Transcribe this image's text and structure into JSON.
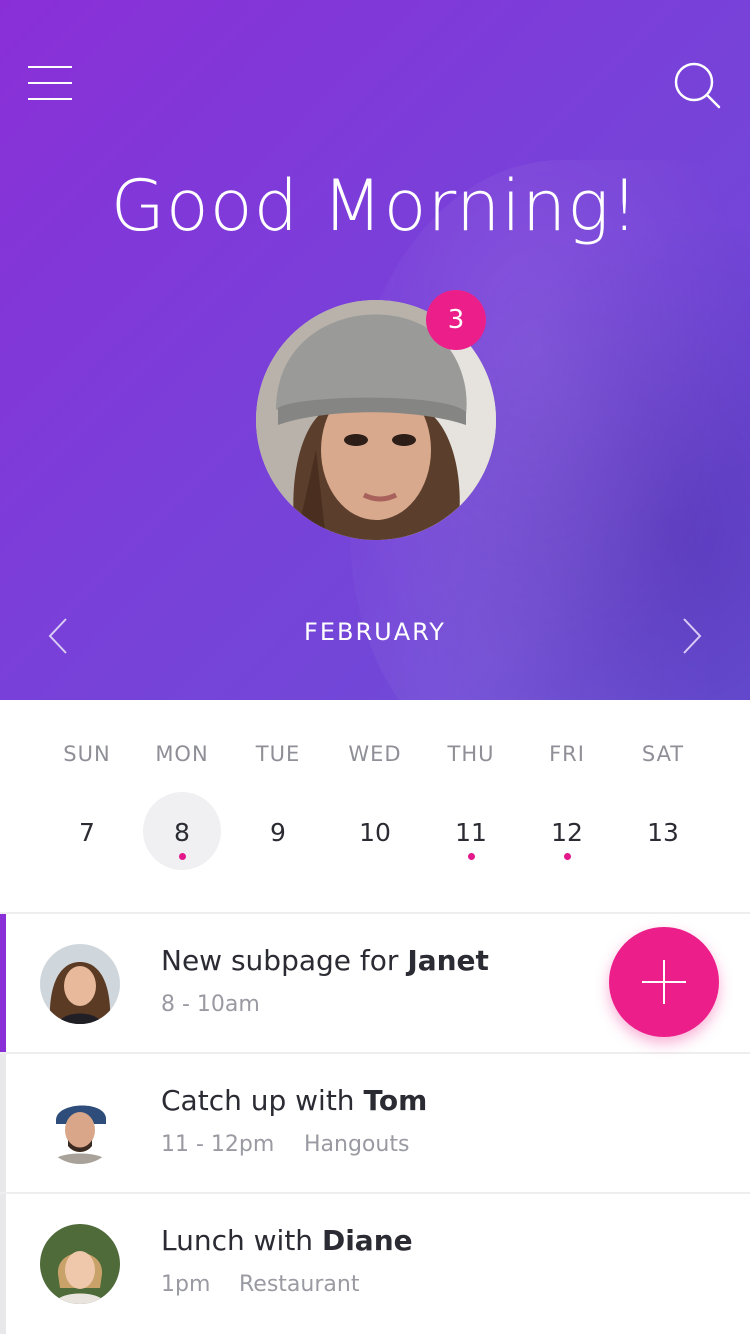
{
  "header": {
    "greeting": "Good Morning!",
    "notification_count": "3",
    "month": "FEBRUARY"
  },
  "week": {
    "days": [
      {
        "name": "SUN",
        "num": "7",
        "selected": false,
        "has_event": false
      },
      {
        "name": "MON",
        "num": "8",
        "selected": true,
        "has_event": true
      },
      {
        "name": "TUE",
        "num": "9",
        "selected": false,
        "has_event": false
      },
      {
        "name": "WED",
        "num": "10",
        "selected": false,
        "has_event": false
      },
      {
        "name": "THU",
        "num": "11",
        "selected": false,
        "has_event": true
      },
      {
        "name": "FRI",
        "num": "12",
        "selected": false,
        "has_event": true
      },
      {
        "name": "SAT",
        "num": "13",
        "selected": false,
        "has_event": false
      }
    ]
  },
  "events": [
    {
      "title_prefix": "New subpage for ",
      "title_name": "Janet",
      "time": "8 - 10am",
      "place": ""
    },
    {
      "title_prefix": "Catch up with ",
      "title_name": "Tom",
      "time": "11 - 12pm",
      "place": "Hangouts"
    },
    {
      "title_prefix": "Lunch with ",
      "title_name": "Diane",
      "time": "1pm",
      "place": "Restaurant"
    }
  ],
  "colors": {
    "accent_pink": "#ec1f8a",
    "accent_purple": "#8a2fd8"
  },
  "icons": {
    "menu": "menu-icon",
    "search": "search-icon",
    "prev": "chevron-left-icon",
    "next": "chevron-right-icon",
    "add": "plus-icon"
  }
}
